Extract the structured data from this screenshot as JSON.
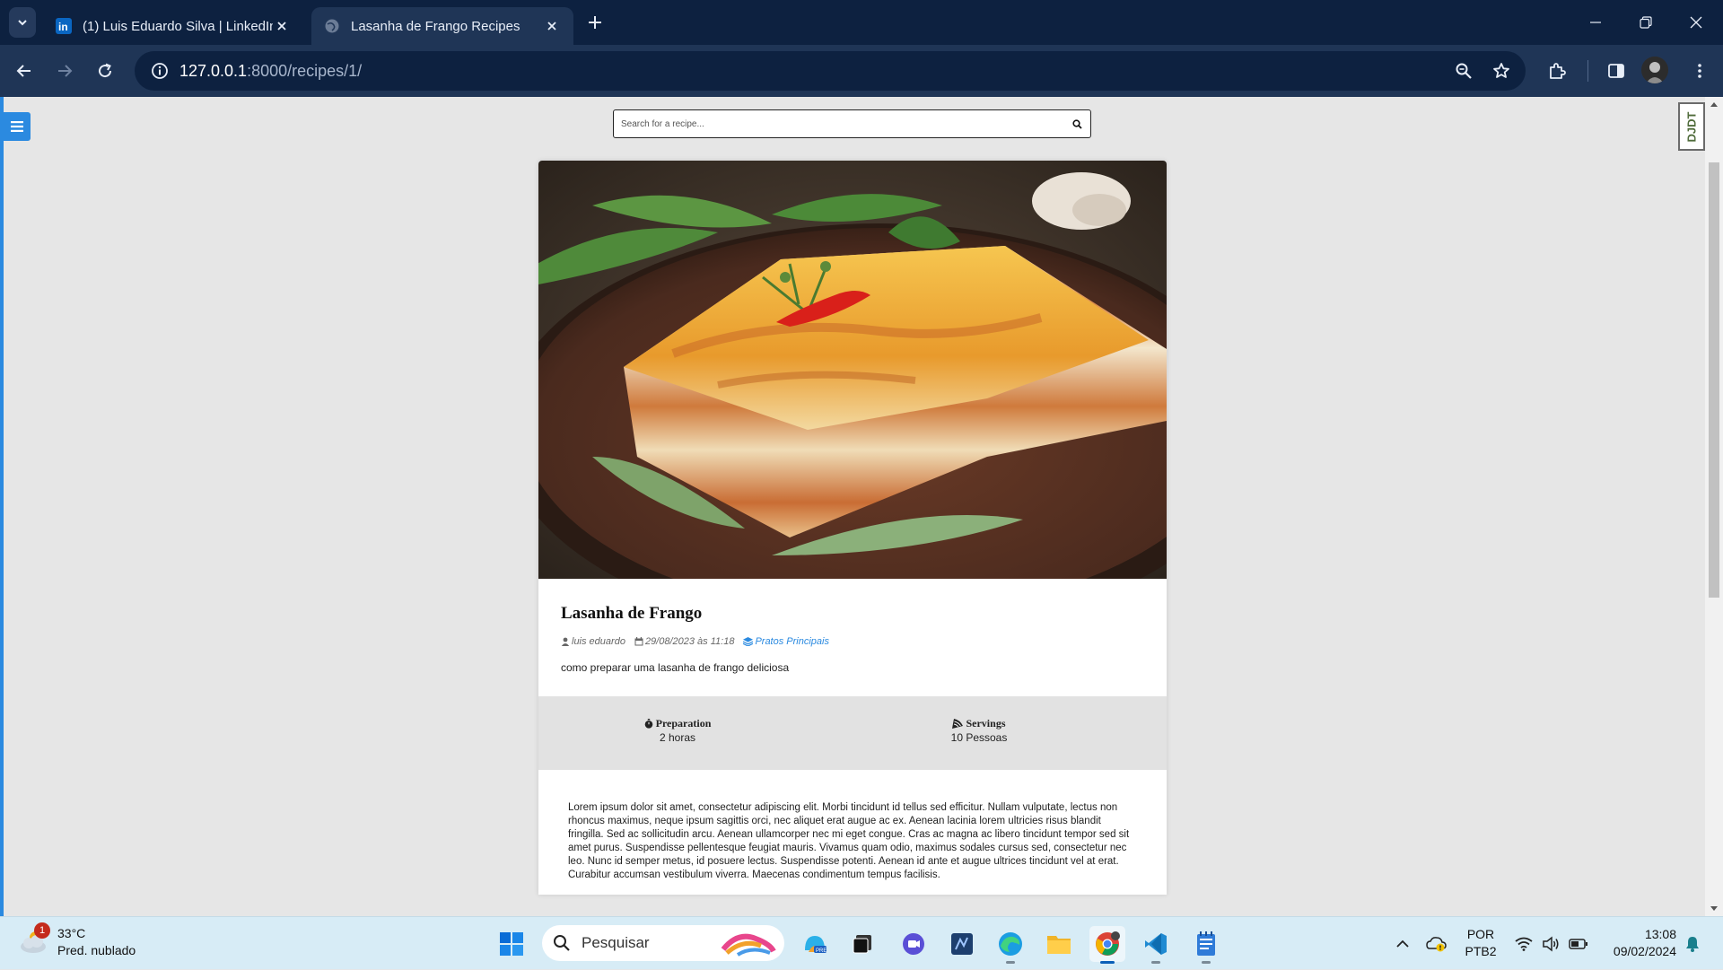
{
  "browser": {
    "tabs": [
      {
        "title": "(1) Luis Eduardo Silva | LinkedIn",
        "favicon": "linkedin-icon",
        "active": false
      },
      {
        "title": "Lasanha de Frango Recipes",
        "favicon": "globe-icon",
        "active": true
      }
    ],
    "url_host": "127.0.0.1",
    "url_rest": ":8000/recipes/1/",
    "colors": {
      "titlebar": "#0d2140",
      "toolbar": "#1f3556",
      "accent": "#2b8ae0"
    }
  },
  "page": {
    "search_placeholder": "Search for a recipe...",
    "recipe": {
      "title": "Lasanha de Frango",
      "author": "luis eduardo",
      "date": "29/08/2023 às 11:18",
      "category": "Pratos Principais",
      "description": "como preparar uma lasanha de frango deliciosa",
      "preparation_label": "Preparation",
      "preparation_value": "2 horas",
      "servings_label": "Servings",
      "servings_value": "10 Pessoas",
      "body": "Lorem ipsum dolor sit amet, consectetur adipiscing elit. Morbi tincidunt id tellus sed efficitur. Nullam vulputate, lectus non rhoncus maximus, neque ipsum sagittis orci, nec aliquet erat augue ac ex. Aenean lacinia lorem ultricies risus blandit fringilla. Sed ac sollicitudin arcu. Aenean ullamcorper nec mi eget congue. Cras ac magna ac libero tincidunt tempor sed sit amet purus. Suspendisse pellentesque feugiat mauris. Vivamus quam odio, maximus sodales cursus sed, consectetur nec leo. Nunc id semper metus, id posuere lectus. Suspendisse potenti. Aenean id ante et augue ultrices tincidunt vel at erat. Curabitur accumsan vestibulum viverra. Maecenas condimentum tempus facilisis."
    },
    "debug_toolbar_label": "DJDT"
  },
  "taskbar": {
    "weather_temp": "33°C",
    "weather_desc": "Pred. nublado",
    "weather_badge": "1",
    "search_label": "Pesquisar",
    "lang_line1": "POR",
    "lang_line2": "PTB2",
    "time": "13:08",
    "date": "09/02/2024"
  }
}
